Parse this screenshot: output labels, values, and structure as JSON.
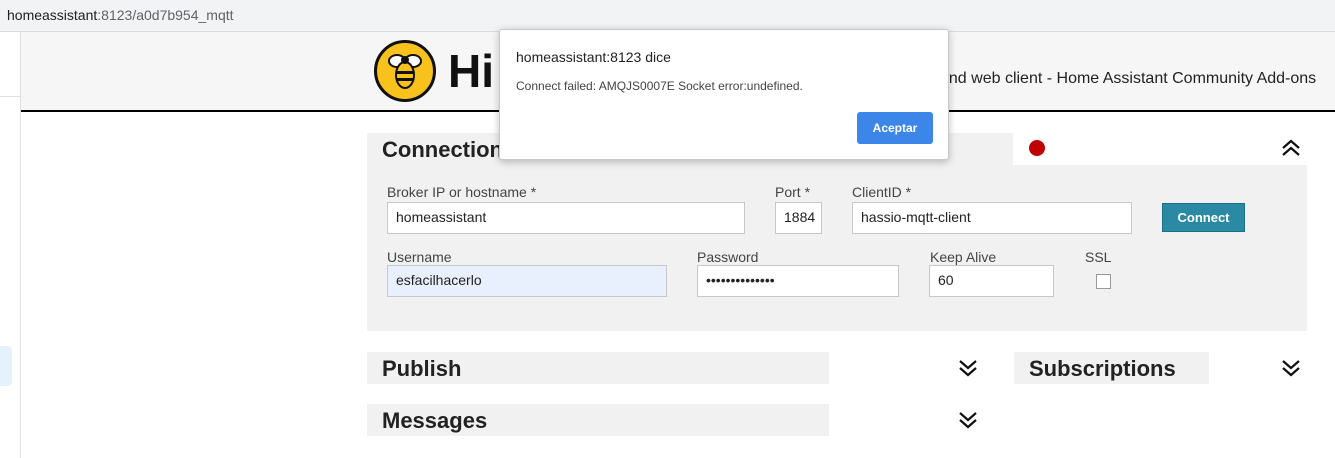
{
  "browser": {
    "url_host": "homeassistant",
    "url_path": ":8123/a0d7b954_mqtt"
  },
  "header": {
    "logo_text": "Hi",
    "title": "and web client - Home Assistant Community Add-ons"
  },
  "connection": {
    "title": "Connection",
    "status_color": "#c00000",
    "broker_label": "Broker IP or hostname *",
    "broker_value": "homeassistant",
    "port_label": "Port *",
    "port_value": "1884",
    "clientid_label": "ClientID *",
    "clientid_value": "hassio-mqtt-client",
    "connect_label": "Connect",
    "username_label": "Username",
    "username_value": "esfacilhacerlo",
    "password_label": "Password",
    "password_value": "••••••••••••••",
    "keepalive_label": "Keep Alive",
    "keepalive_value": "60",
    "ssl_label": "SSL"
  },
  "publish": {
    "title": "Publish"
  },
  "subscriptions": {
    "title": "Subscriptions"
  },
  "messages": {
    "title": "Messages"
  },
  "dialog": {
    "title": "homeassistant:8123 dice",
    "message": "Connect failed: AMQJS0007E Socket error:undefined.",
    "button": "Aceptar"
  },
  "colors": {
    "accent": "#2b8aa3",
    "dialog_button": "#3b86e8"
  }
}
